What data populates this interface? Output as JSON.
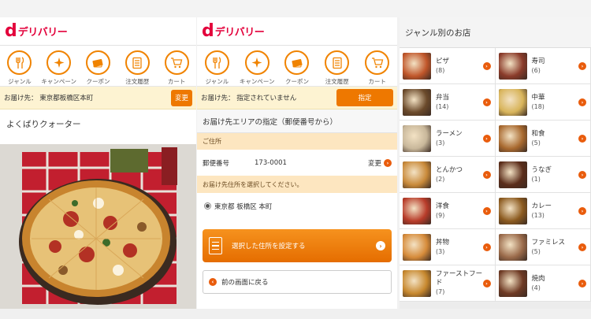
{
  "brand": {
    "logo_d": "d",
    "logo_text": "デリバリー"
  },
  "nav": [
    {
      "icon": "fork-knife-icon",
      "label": "ジャンル"
    },
    {
      "icon": "sparkle-icon",
      "label": "キャンペーン"
    },
    {
      "icon": "coupon-icon",
      "label": "クーポン"
    },
    {
      "icon": "order-history-icon",
      "label": "注文履歴"
    },
    {
      "icon": "cart-icon",
      "label": "カート"
    }
  ],
  "panel_shop": {
    "address_text": "お届け先： 東京都板橋区本町",
    "change_label": "変更",
    "shop_name": "よくばりクォーター"
  },
  "panel_address": {
    "address_text": "お届け先： 指定されていません",
    "set_label": "指定",
    "section_title": "お届け先エリアの指定（郵便番号から）",
    "sub_label": "ご住所",
    "zip_label": "郵便番号",
    "zip_value": "173-0001",
    "zip_change": "変更",
    "notice": "お届け先住所を選択してください。",
    "radio_option": "東京都 板橋区 本町",
    "set_button": "選択した住所を設定する",
    "back_button": "前の画面に戻る"
  },
  "panel_genre": {
    "title": "ジャンル別のお店",
    "genres": [
      {
        "name": "ピザ",
        "count": "(8)",
        "color": "#c0562a"
      },
      {
        "name": "寿司",
        "count": "(6)",
        "color": "#8a3b2a"
      },
      {
        "name": "弁当",
        "count": "(14)",
        "color": "#6b4a2b"
      },
      {
        "name": "中華",
        "count": "(18)",
        "color": "#d8b45a"
      },
      {
        "name": "ラーメン",
        "count": "(3)",
        "color": "#c8b79a"
      },
      {
        "name": "和食",
        "count": "(5)",
        "color": "#a8692f"
      },
      {
        "name": "とんかつ",
        "count": "(2)",
        "color": "#c98a3a"
      },
      {
        "name": "うなぎ",
        "count": "(1)",
        "color": "#5b2d1a"
      },
      {
        "name": "洋食",
        "count": "(9)",
        "color": "#b83c2a"
      },
      {
        "name": "カレー",
        "count": "(13)",
        "color": "#8b5a1f"
      },
      {
        "name": "丼物",
        "count": "(3)",
        "color": "#d68b3a"
      },
      {
        "name": "ファミレス",
        "count": "(5)",
        "color": "#9a6a4a"
      },
      {
        "name": "ファーストフード",
        "count": "(7)",
        "color": "#c7882e"
      },
      {
        "name": "焼肉",
        "count": "(4)",
        "color": "#6e3a24"
      }
    ]
  }
}
